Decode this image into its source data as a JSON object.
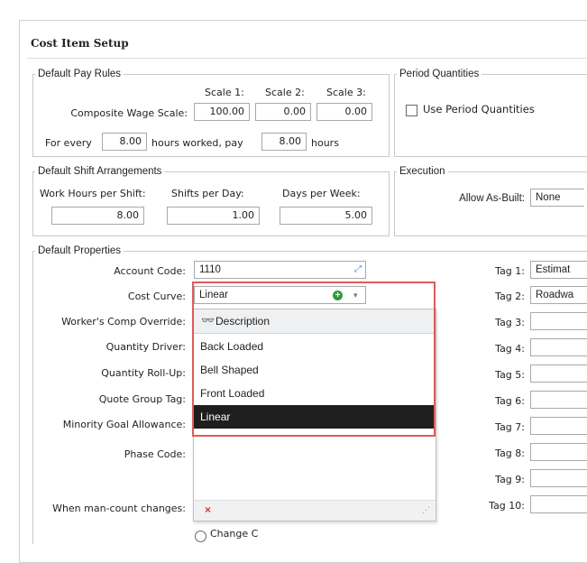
{
  "window": {
    "title": "Cost Item Setup"
  },
  "pay_rules": {
    "legend": "Default Pay Rules",
    "scale1_label": "Scale 1:",
    "scale2_label": "Scale 2:",
    "scale3_label": "Scale 3:",
    "composite_label": "Composite Wage Scale:",
    "scale1": "100.00",
    "scale2": "0.00",
    "scale3": "0.00",
    "for_every_label": "For every",
    "hours_value": "8.00",
    "worked_label": "hours worked, pay",
    "pay_value": "8.00",
    "hours_label": "hours"
  },
  "period": {
    "legend": "Period Quantities",
    "use_label": "Use Period Quantities",
    "checked": false
  },
  "shift": {
    "legend": "Default Shift Arrangements",
    "work_hours_label": "Work Hours per Shift:",
    "shifts_label": "Shifts per Day:",
    "days_label": "Days per Week:",
    "work_hours": "8.00",
    "shifts": "1.00",
    "days": "5.00"
  },
  "execution": {
    "legend": "Execution",
    "as_built_label": "Allow As-Built:",
    "as_built_value": "None"
  },
  "properties": {
    "legend": "Default Properties",
    "account_code_label": "Account Code:",
    "account_code": "1110",
    "cost_curve_label": "Cost Curve:",
    "cost_curve": "Linear",
    "workers_comp_label": "Worker's Comp Override:",
    "quantity_driver_label": "Quantity Driver:",
    "rollup_label": "Quantity Roll-Up:",
    "quote_group_label": "Quote Group Tag:",
    "minority_label": "Minority Goal Allowance:",
    "phase_code_label": "Phase Code:",
    "man_count_label": "When man-count changes:",
    "radio_label": "Change C"
  },
  "tags": [
    {
      "label": "Tag 1:",
      "value": "Estimat"
    },
    {
      "label": "Tag 2:",
      "value": "Roadwa"
    },
    {
      "label": "Tag 3:",
      "value": ""
    },
    {
      "label": "Tag 4:",
      "value": ""
    },
    {
      "label": "Tag 5:",
      "value": ""
    },
    {
      "label": "Tag 6:",
      "value": ""
    },
    {
      "label": "Tag 7:",
      "value": ""
    },
    {
      "label": "Tag 8:",
      "value": ""
    },
    {
      "label": "Tag 9:",
      "value": ""
    },
    {
      "label": "Tag 10:",
      "value": ""
    }
  ],
  "dropdown": {
    "header_label": "Description",
    "options": [
      "Back Loaded",
      "Bell Shaped",
      "Front Loaded",
      "Linear"
    ],
    "selected": "Linear"
  },
  "colors": {
    "highlight": "#e25a5a",
    "selected_bg": "#1e1e1e",
    "add_green": "#2e9b3a",
    "clear_red": "#d93636"
  }
}
